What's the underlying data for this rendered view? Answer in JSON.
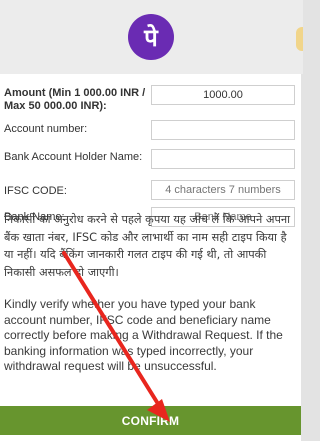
{
  "header": {
    "logo_glyph": "पे"
  },
  "form": {
    "amount": {
      "label": "Amount (Min 1 000.00 INR / Max 50 000.00 INR):",
      "value": "1000.00"
    },
    "account_number": {
      "label": "Account number:",
      "value": ""
    },
    "holder_name": {
      "label": "Bank Account Holder Name:",
      "value": ""
    },
    "ifsc": {
      "label": "IFSC CODE:",
      "placeholder": "4 characters 7 numbers"
    },
    "bank_name": {
      "label": "Bank Name:",
      "placeholder": "Bank Name"
    }
  },
  "notice": {
    "hindi": "निकासी का अनुरोध करने से पहले कृपया यह जांच लें कि आपने अपना बैंक खाता नंबर, IFSC कोड और लाभार्थी का नाम सही टाइप किया है या नहीं। यदि बैंकिंग जानकारी गलत टाइप की गई थी, तो आपकी निकासी असफल हो जाएगी।",
    "english": "Kindly verify whether you have typed your bank account number, IFSC code and beneficiary name correctly before making a Withdrawal Request. If the banking information was typed incorrectly, your withdrawal request will be unsuccessful."
  },
  "confirm_label": "CONFIRM",
  "colors": {
    "logo": "#6a2bb3",
    "confirm": "#67952e",
    "arrow": "#e8261e"
  },
  "icons": [
    "phonepe-logo-icon",
    "annotation-arrow-icon"
  ]
}
